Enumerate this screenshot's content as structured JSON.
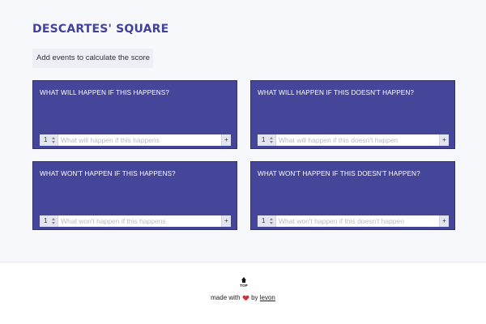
{
  "header": {
    "title": "DESCARTES' SQUARE",
    "score_text": "Add events to calculate the score"
  },
  "quadrants": [
    {
      "question": "WHAT WILL HAPPEN IF THIS HAPPENS?",
      "count": "1",
      "placeholder": "What will happen if this happens",
      "add_label": "+"
    },
    {
      "question": "WHAT WILL HAPPEN IF THIS DOESN'T HAPPEN?",
      "count": "1",
      "placeholder": "What will happen if this doesn't happen",
      "add_label": "+"
    },
    {
      "question": "WHAT WON'T HAPPEN IF THIS HAPPENS?",
      "count": "1",
      "placeholder": "What won't happen if this happens",
      "add_label": "+"
    },
    {
      "question": "WHAT WON'T HAPPEN IF THIS DOESN'T HAPPEN?",
      "count": "1",
      "placeholder": "What won't happen if this doesn't happen",
      "add_label": "+"
    }
  ],
  "footer": {
    "top_label": "TOP",
    "made_with": "made with",
    "by": "by",
    "author": "levon"
  },
  "icons": {
    "top": "arrow-up-icon",
    "heart": "heart-icon",
    "spinner": "spinner-icon"
  },
  "colors": {
    "card_bg": "#454599",
    "title": "#42429a",
    "heart": "#d62e3c",
    "page_bg": "#f7f8fc"
  }
}
